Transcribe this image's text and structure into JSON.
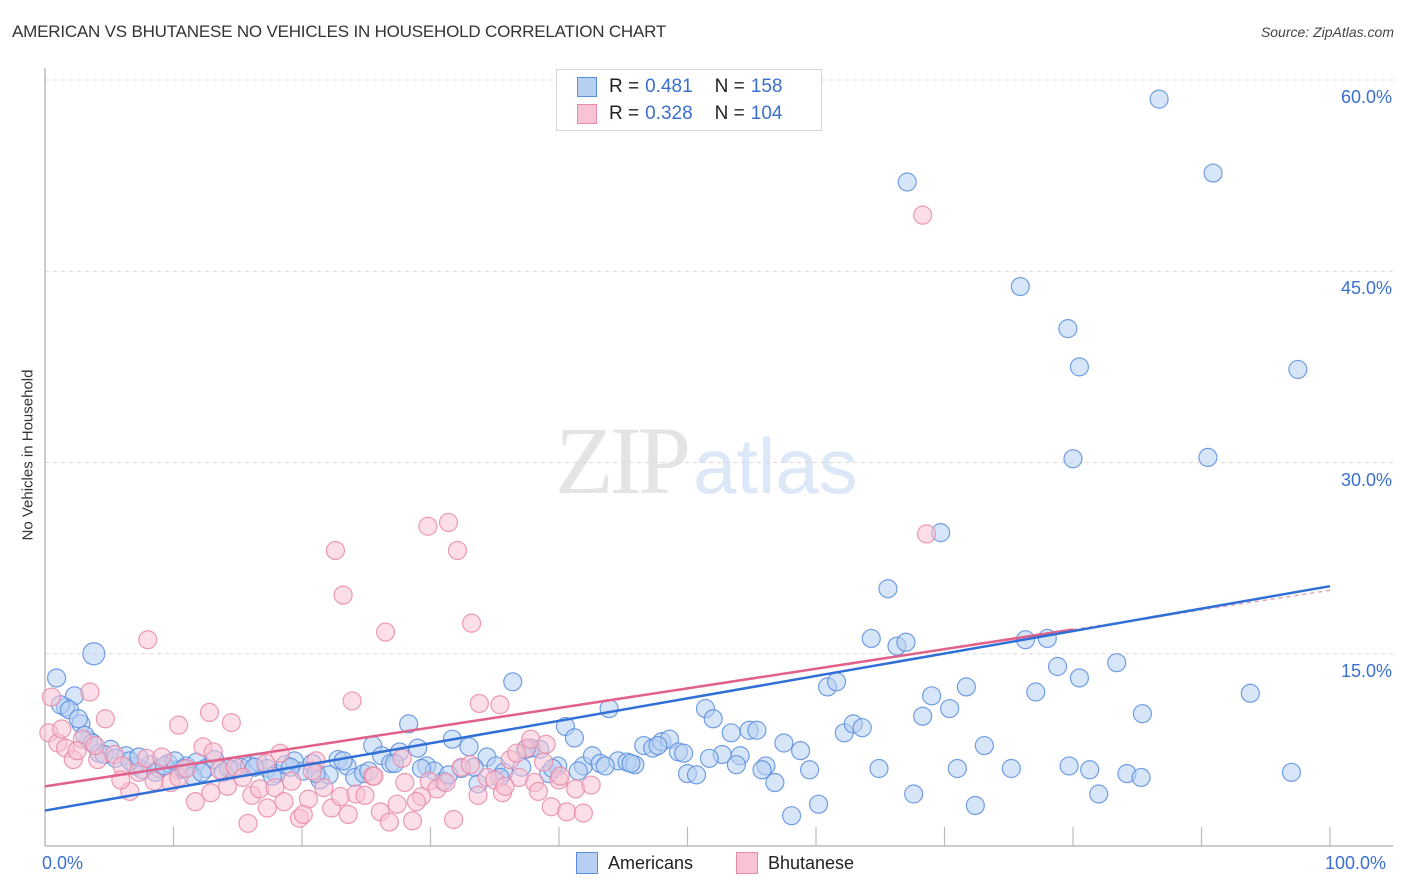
{
  "header": {
    "title": "AMERICAN VS BHUTANESE NO VEHICLES IN HOUSEHOLD CORRELATION CHART",
    "source": "Source: ZipAtlas.com"
  },
  "watermark": {
    "zip": "ZIP",
    "atlas": "atlas"
  },
  "legend": {
    "rows": [
      {
        "r_label": "R =",
        "r_value": "0.481",
        "n_label": "N =",
        "n_value": "158"
      },
      {
        "r_label": "R =",
        "r_value": "0.328",
        "n_label": "N =",
        "n_value": "104"
      }
    ],
    "bottom": [
      "Americans",
      "Bhutanese"
    ]
  },
  "colors": {
    "americans_fill": "#b7d0f2",
    "americans_stroke": "#5b8ede",
    "americans_line": "#2f6fd6",
    "bhutanese_fill": "#f8c3d3",
    "bhutanese_stroke": "#e98aa8",
    "bhutanese_line": "#e2618a",
    "tick_label": "#3a6fd1"
  },
  "chart_data": {
    "type": "scatter",
    "title": "AMERICAN VS BHUTANESE NO VEHICLES IN HOUSEHOLD CORRELATION CHART",
    "xlabel": "",
    "ylabel": "No Vehicles in Household",
    "xlim": [
      0,
      100
    ],
    "ylim": [
      0,
      62
    ],
    "x_tick_labels": [
      "0.0%",
      "100.0%"
    ],
    "y_ticks": [
      15,
      30,
      45,
      60
    ],
    "y_tick_labels": [
      "15.0%",
      "30.0%",
      "45.0%",
      "60.0%"
    ],
    "grid": "horizontal-dashed",
    "legend_placement": "top-center",
    "series": [
      {
        "name": "Americans",
        "R": 0.481,
        "N": 158,
        "trend": {
          "x0": 0,
          "y0": 2.7,
          "x1": 100,
          "y1": 20.3
        },
        "points": [
          [
            3.8,
            15.0
          ],
          [
            0.9,
            13.1
          ],
          [
            2.3,
            11.7
          ],
          [
            1.6,
            10.8
          ],
          [
            2.8,
            9.5
          ],
          [
            3.4,
            8.2
          ],
          [
            4.2,
            7.2
          ],
          [
            5.1,
            7.5
          ],
          [
            6.3,
            7.0
          ],
          [
            7.0,
            6.2
          ],
          [
            7.6,
            5.9
          ],
          [
            8.2,
            6.3
          ],
          [
            8.9,
            6.0
          ],
          [
            9.6,
            6.4
          ],
          [
            10.4,
            5.9
          ],
          [
            11.0,
            6.2
          ],
          [
            11.8,
            6.5
          ],
          [
            12.5,
            6.0
          ],
          [
            13.2,
            6.7
          ],
          [
            13.9,
            5.7
          ],
          [
            14.6,
            5.9
          ],
          [
            15.2,
            6.1
          ],
          [
            15.9,
            6.2
          ],
          [
            16.6,
            6.5
          ],
          [
            17.3,
            6.0
          ],
          [
            18.0,
            5.6
          ],
          [
            18.7,
            6.3
          ],
          [
            19.4,
            6.6
          ],
          [
            20.1,
            5.8
          ],
          [
            20.8,
            6.4
          ],
          [
            21.4,
            5.1
          ],
          [
            22.1,
            5.5
          ],
          [
            22.8,
            6.7
          ],
          [
            23.5,
            6.2
          ],
          [
            24.1,
            5.3
          ],
          [
            24.8,
            5.6
          ],
          [
            25.5,
            7.8
          ],
          [
            26.2,
            7.0
          ],
          [
            26.9,
            6.4
          ],
          [
            27.6,
            7.3
          ],
          [
            28.3,
            9.5
          ],
          [
            29.0,
            7.6
          ],
          [
            29.7,
            6.2
          ],
          [
            30.3,
            5.8
          ],
          [
            31.0,
            5.0
          ],
          [
            31.7,
            8.3
          ],
          [
            32.4,
            6.0
          ],
          [
            33.0,
            7.7
          ],
          [
            33.7,
            4.8
          ],
          [
            34.4,
            6.9
          ],
          [
            35.1,
            6.2
          ],
          [
            35.7,
            5.7
          ],
          [
            36.4,
            12.8
          ],
          [
            37.1,
            6.1
          ],
          [
            37.8,
            7.6
          ],
          [
            38.5,
            7.5
          ],
          [
            39.2,
            5.6
          ],
          [
            39.9,
            6.2
          ],
          [
            40.5,
            9.3
          ],
          [
            41.2,
            8.4
          ],
          [
            41.9,
            6.2
          ],
          [
            42.6,
            7.0
          ],
          [
            43.2,
            6.4
          ],
          [
            43.9,
            10.7
          ],
          [
            44.6,
            6.6
          ],
          [
            45.3,
            6.5
          ],
          [
            45.9,
            6.3
          ],
          [
            46.6,
            7.8
          ],
          [
            47.3,
            7.6
          ],
          [
            48.0,
            8.1
          ],
          [
            48.6,
            8.3
          ],
          [
            49.3,
            7.3
          ],
          [
            50.0,
            5.6
          ],
          [
            50.7,
            5.5
          ],
          [
            51.4,
            10.7
          ],
          [
            52.0,
            9.9
          ],
          [
            52.7,
            7.1
          ],
          [
            53.4,
            8.8
          ],
          [
            54.1,
            7.0
          ],
          [
            54.8,
            9.0
          ],
          [
            55.4,
            9.0
          ],
          [
            56.1,
            6.2
          ],
          [
            56.8,
            4.9
          ],
          [
            57.5,
            8.0
          ],
          [
            58.1,
            2.3
          ],
          [
            58.8,
            7.4
          ],
          [
            59.5,
            5.9
          ],
          [
            60.2,
            3.2
          ],
          [
            60.9,
            12.4
          ],
          [
            61.6,
            12.8
          ],
          [
            62.2,
            8.8
          ],
          [
            62.9,
            9.5
          ],
          [
            63.6,
            9.2
          ],
          [
            64.3,
            16.2
          ],
          [
            64.9,
            6.0
          ],
          [
            65.6,
            20.1
          ],
          [
            66.3,
            15.6
          ],
          [
            67.0,
            15.9
          ],
          [
            67.6,
            4.0
          ],
          [
            68.3,
            10.1
          ],
          [
            69.0,
            11.7
          ],
          [
            69.7,
            24.5
          ],
          [
            70.4,
            10.7
          ],
          [
            71.0,
            6.0
          ],
          [
            71.7,
            12.4
          ],
          [
            72.4,
            3.1
          ],
          [
            73.1,
            7.8
          ],
          [
            67.1,
            52.0
          ],
          [
            75.2,
            6.0
          ],
          [
            76.3,
            16.1
          ],
          [
            77.1,
            12.0
          ],
          [
            78.0,
            16.2
          ],
          [
            78.8,
            14.0
          ],
          [
            79.7,
            6.2
          ],
          [
            80.5,
            13.1
          ],
          [
            81.3,
            5.9
          ],
          [
            82.0,
            4.0
          ],
          [
            83.4,
            14.3
          ],
          [
            84.2,
            5.6
          ],
          [
            85.3,
            5.3
          ],
          [
            75.9,
            43.8
          ],
          [
            79.6,
            40.5
          ],
          [
            80.5,
            37.5
          ],
          [
            80.0,
            30.3
          ],
          [
            85.4,
            10.3
          ],
          [
            86.7,
            58.5
          ],
          [
            90.9,
            52.7
          ],
          [
            90.5,
            30.4
          ],
          [
            97.5,
            37.3
          ],
          [
            93.8,
            11.9
          ],
          [
            97.0,
            5.7
          ],
          [
            1.2,
            11.0
          ],
          [
            1.9,
            10.6
          ],
          [
            2.6,
            9.9
          ],
          [
            3.1,
            8.6
          ],
          [
            3.7,
            8.0
          ],
          [
            4.6,
            7.1
          ],
          [
            5.5,
            6.8
          ],
          [
            6.6,
            6.6
          ],
          [
            7.3,
            6.9
          ],
          [
            8.6,
            5.7
          ],
          [
            9.3,
            6.2
          ],
          [
            10.1,
            6.6
          ],
          [
            10.8,
            6.0
          ],
          [
            11.5,
            5.4
          ],
          [
            12.2,
            5.7
          ],
          [
            14.3,
            6.0
          ],
          [
            16.3,
            6.1
          ],
          [
            17.7,
            5.4
          ],
          [
            19.1,
            6.1
          ],
          [
            21.1,
            5.6
          ],
          [
            23.2,
            6.6
          ],
          [
            25.2,
            5.8
          ],
          [
            27.2,
            6.4
          ],
          [
            29.3,
            6.0
          ],
          [
            31.4,
            5.5
          ],
          [
            33.4,
            6.1
          ],
          [
            35.4,
            5.3
          ],
          [
            37.4,
            7.5
          ],
          [
            39.5,
            6.0
          ],
          [
            41.5,
            5.8
          ],
          [
            43.6,
            6.2
          ],
          [
            45.6,
            6.4
          ],
          [
            47.7,
            7.8
          ],
          [
            49.7,
            7.2
          ],
          [
            51.7,
            6.8
          ],
          [
            53.8,
            6.3
          ],
          [
            55.8,
            5.9
          ]
        ]
      },
      {
        "name": "Bhutanese",
        "R": 0.328,
        "N": 104,
        "trend": {
          "x0": 0,
          "y0": 4.6,
          "x1": 80,
          "y1": 16.9
        },
        "points": [
          [
            0.5,
            11.6
          ],
          [
            0.3,
            8.8
          ],
          [
            1.0,
            8.0
          ],
          [
            1.6,
            7.6
          ],
          [
            2.2,
            6.7
          ],
          [
            2.9,
            8.3
          ],
          [
            3.5,
            12.0
          ],
          [
            4.1,
            6.7
          ],
          [
            4.7,
            9.9
          ],
          [
            5.4,
            7.1
          ],
          [
            6.0,
            6.2
          ],
          [
            6.6,
            4.2
          ],
          [
            7.3,
            5.7
          ],
          [
            7.9,
            6.8
          ],
          [
            8.5,
            5.0
          ],
          [
            9.1,
            6.9
          ],
          [
            9.8,
            4.9
          ],
          [
            10.4,
            5.3
          ],
          [
            11.0,
            6.0
          ],
          [
            11.7,
            3.4
          ],
          [
            12.3,
            7.7
          ],
          [
            12.9,
            4.1
          ],
          [
            13.6,
            5.9
          ],
          [
            14.2,
            4.6
          ],
          [
            14.8,
            6.1
          ],
          [
            15.4,
            5.3
          ],
          [
            16.1,
            3.9
          ],
          [
            16.7,
            4.4
          ],
          [
            17.3,
            2.9
          ],
          [
            17.9,
            4.5
          ],
          [
            18.6,
            3.4
          ],
          [
            19.2,
            5.0
          ],
          [
            19.8,
            2.1
          ],
          [
            20.5,
            3.6
          ],
          [
            21.1,
            6.6
          ],
          [
            21.7,
            4.5
          ],
          [
            22.3,
            2.9
          ],
          [
            23.0,
            3.8
          ],
          [
            23.6,
            2.4
          ],
          [
            24.2,
            4.0
          ],
          [
            24.9,
            3.9
          ],
          [
            25.5,
            5.4
          ],
          [
            26.1,
            2.6
          ],
          [
            26.8,
            1.8
          ],
          [
            27.4,
            3.2
          ],
          [
            28.0,
            4.9
          ],
          [
            28.6,
            1.9
          ],
          [
            29.3,
            3.8
          ],
          [
            29.9,
            5.0
          ],
          [
            30.5,
            4.4
          ],
          [
            31.2,
            4.9
          ],
          [
            31.8,
            2.0
          ],
          [
            32.4,
            6.1
          ],
          [
            33.1,
            6.3
          ],
          [
            33.7,
            3.9
          ],
          [
            34.4,
            5.3
          ],
          [
            35.0,
            5.1
          ],
          [
            35.6,
            4.1
          ],
          [
            36.2,
            6.7
          ],
          [
            36.9,
            5.3
          ],
          [
            37.5,
            7.6
          ],
          [
            38.1,
            4.9
          ],
          [
            38.8,
            6.5
          ],
          [
            39.4,
            3.0
          ],
          [
            40.0,
            5.1
          ],
          [
            40.6,
            2.6
          ],
          [
            41.3,
            4.4
          ],
          [
            41.9,
            2.5
          ],
          [
            42.5,
            4.7
          ],
          [
            8.0,
            16.1
          ],
          [
            10.4,
            9.4
          ],
          [
            12.8,
            10.4
          ],
          [
            14.5,
            9.6
          ],
          [
            17.2,
            6.4
          ],
          [
            18.3,
            7.2
          ],
          [
            20.8,
            5.8
          ],
          [
            22.6,
            23.1
          ],
          [
            23.2,
            19.6
          ],
          [
            23.9,
            11.3
          ],
          [
            25.6,
            5.4
          ],
          [
            26.5,
            16.7
          ],
          [
            27.8,
            6.8
          ],
          [
            28.9,
            3.4
          ],
          [
            29.8,
            25.0
          ],
          [
            31.4,
            25.3
          ],
          [
            32.1,
            23.1
          ],
          [
            33.2,
            17.4
          ],
          [
            33.8,
            11.1
          ],
          [
            35.4,
            11.0
          ],
          [
            36.7,
            7.2
          ],
          [
            37.8,
            8.3
          ],
          [
            38.4,
            4.2
          ],
          [
            39.0,
            7.9
          ],
          [
            40.1,
            5.4
          ],
          [
            68.6,
            24.4
          ],
          [
            68.3,
            49.4
          ],
          [
            1.3,
            9.1
          ],
          [
            2.5,
            7.4
          ],
          [
            3.9,
            7.8
          ],
          [
            5.9,
            5.1
          ],
          [
            13.1,
            7.3
          ],
          [
            15.8,
            1.7
          ],
          [
            20.1,
            2.4
          ],
          [
            35.8,
            4.6
          ]
        ]
      }
    ]
  }
}
